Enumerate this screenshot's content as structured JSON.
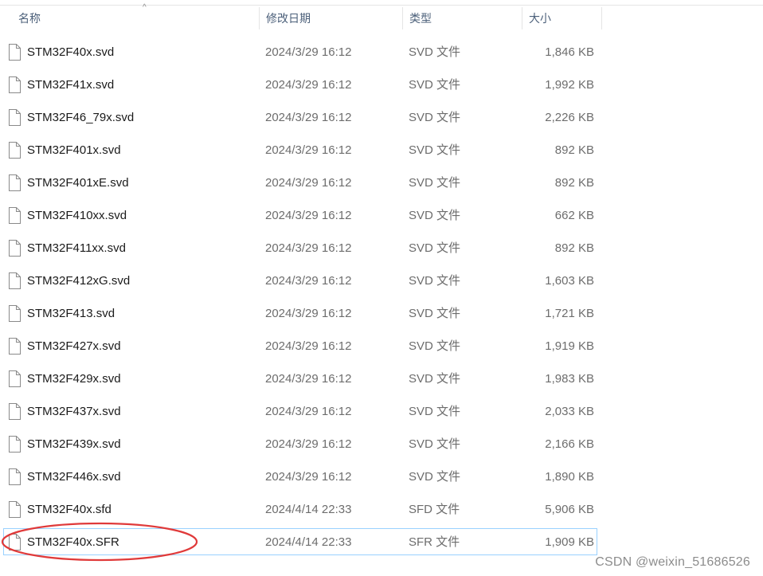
{
  "header": {
    "columns": {
      "name": "名称",
      "date": "修改日期",
      "type": "类型",
      "size": "大小"
    },
    "sort_indicator": "^"
  },
  "files": [
    {
      "name": "STM32F40x.svd",
      "date": "2024/3/29 16:12",
      "type": "SVD 文件",
      "size": "1,846 KB"
    },
    {
      "name": "STM32F41x.svd",
      "date": "2024/3/29 16:12",
      "type": "SVD 文件",
      "size": "1,992 KB"
    },
    {
      "name": "STM32F46_79x.svd",
      "date": "2024/3/29 16:12",
      "type": "SVD 文件",
      "size": "2,226 KB"
    },
    {
      "name": "STM32F401x.svd",
      "date": "2024/3/29 16:12",
      "type": "SVD 文件",
      "size": "892 KB"
    },
    {
      "name": "STM32F401xE.svd",
      "date": "2024/3/29 16:12",
      "type": "SVD 文件",
      "size": "892 KB"
    },
    {
      "name": "STM32F410xx.svd",
      "date": "2024/3/29 16:12",
      "type": "SVD 文件",
      "size": "662 KB"
    },
    {
      "name": "STM32F411xx.svd",
      "date": "2024/3/29 16:12",
      "type": "SVD 文件",
      "size": "892 KB"
    },
    {
      "name": "STM32F412xG.svd",
      "date": "2024/3/29 16:12",
      "type": "SVD 文件",
      "size": "1,603 KB"
    },
    {
      "name": "STM32F413.svd",
      "date": "2024/3/29 16:12",
      "type": "SVD 文件",
      "size": "1,721 KB"
    },
    {
      "name": "STM32F427x.svd",
      "date": "2024/3/29 16:12",
      "type": "SVD 文件",
      "size": "1,919 KB"
    },
    {
      "name": "STM32F429x.svd",
      "date": "2024/3/29 16:12",
      "type": "SVD 文件",
      "size": "1,983 KB"
    },
    {
      "name": "STM32F437x.svd",
      "date": "2024/3/29 16:12",
      "type": "SVD 文件",
      "size": "2,033 KB"
    },
    {
      "name": "STM32F439x.svd",
      "date": "2024/3/29 16:12",
      "type": "SVD 文件",
      "size": "2,166 KB"
    },
    {
      "name": "STM32F446x.svd",
      "date": "2024/3/29 16:12",
      "type": "SVD 文件",
      "size": "1,890 KB"
    },
    {
      "name": "STM32F40x.sfd",
      "date": "2024/4/14 22:33",
      "type": "SFD 文件",
      "size": "5,906 KB"
    },
    {
      "name": "STM32F40x.SFR",
      "date": "2024/4/14 22:33",
      "type": "SFR 文件",
      "size": "1,909 KB",
      "selected": true
    }
  ],
  "annotation": {
    "color": "#e03a3a"
  },
  "watermark": "CSDN @weixin_51686526",
  "colors": {
    "header_text": "#4c607a",
    "selection_border": "#99d1ff",
    "secondary_text": "#6d6d6d"
  }
}
